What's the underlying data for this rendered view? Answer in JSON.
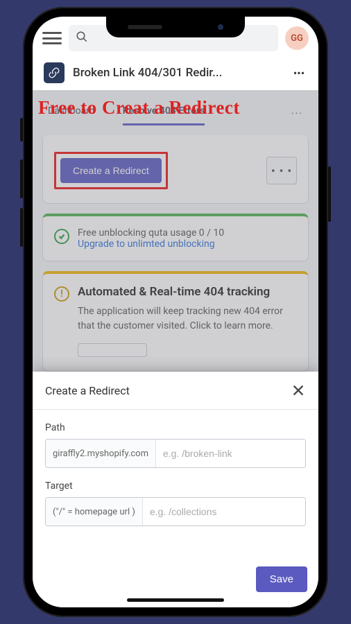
{
  "header": {
    "avatar_initials": "GG",
    "app_title": "Broken Link 404/301 Redir..."
  },
  "annotation": "Free to Creat a Redirect",
  "tabs": {
    "dashboard": "Dashboard",
    "resolve": "Resolve 404 Errors",
    "more": "..."
  },
  "actions": {
    "create_redirect": "Create a Redirect",
    "more_dots": "• • •"
  },
  "quota": {
    "text": "Free unblocking quta usage 0 / 10",
    "upgrade": "Upgrade to unlimted unblocking"
  },
  "tracking": {
    "title": "Automated & Real-time 404 tracking",
    "body": "The application will keep tracking new 404 error that the customer visited. Click to learn more."
  },
  "sheet": {
    "title": "Create a Redirect",
    "path_label": "Path",
    "path_prefix": "giraffly2.myshopify.com",
    "path_placeholder": "e.g. /broken-link",
    "target_label": "Target",
    "target_prefix": "(\"/\" = homepage url )",
    "target_placeholder": "e.g. /collections",
    "save": "Save"
  }
}
